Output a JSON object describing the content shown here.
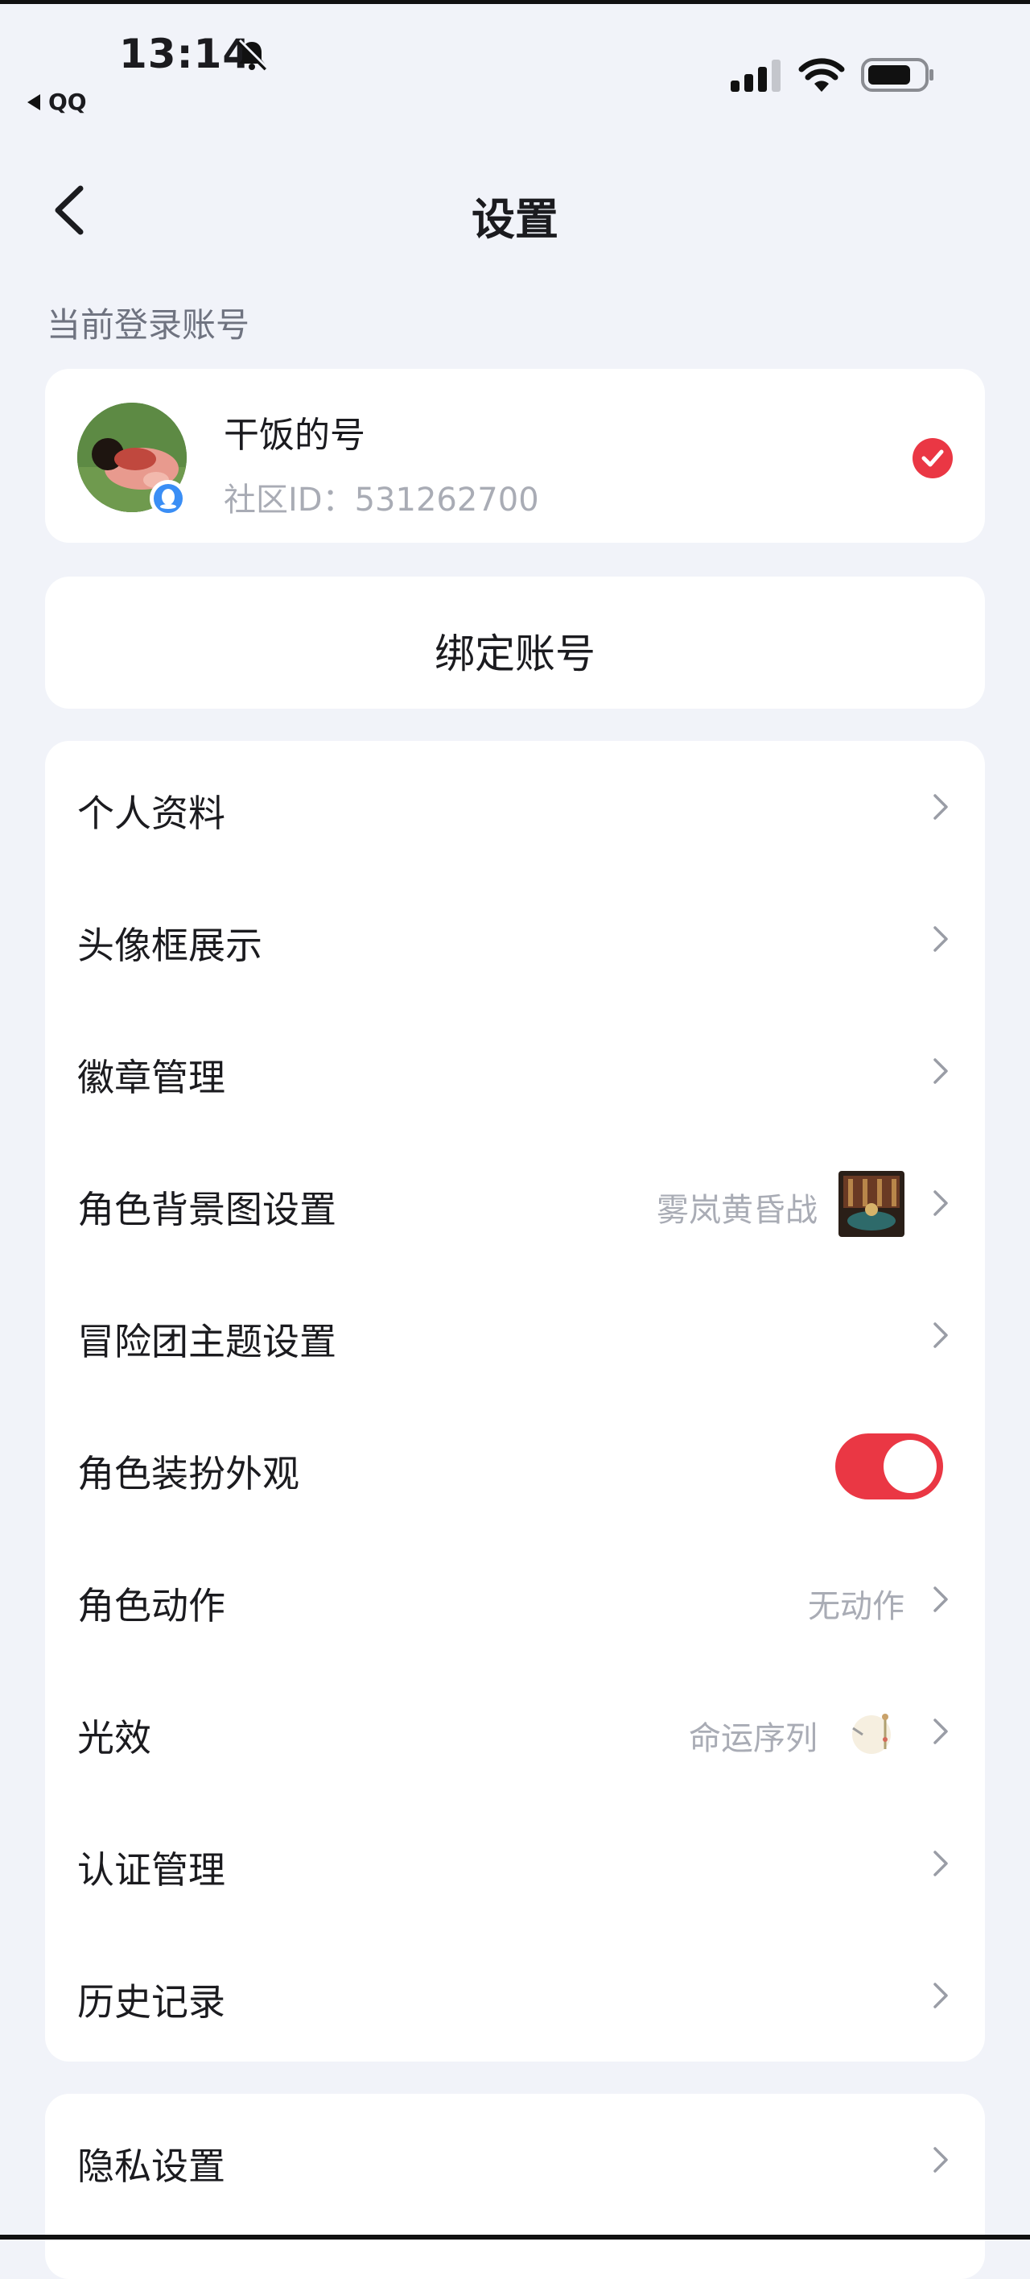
{
  "status_bar": {
    "time": "13:14",
    "back_app": "QQ",
    "icons": [
      "bell-mute-icon",
      "signal-icon",
      "wifi-icon",
      "battery-icon"
    ]
  },
  "nav": {
    "title": "设置",
    "back_icon": "chevron-left-icon"
  },
  "account": {
    "section_label": "当前登录账号",
    "name": "干饭的号",
    "community_id": "社区ID：531262700",
    "selected": true
  },
  "bind": {
    "label": "绑定账号"
  },
  "menu": {
    "items": [
      {
        "label": "个人资料"
      },
      {
        "label": "头像框展示"
      },
      {
        "label": "徽章管理"
      },
      {
        "label": "角色背景图设置",
        "value": "雾岚黄昏战"
      },
      {
        "label": "冒险团主题设置"
      },
      {
        "label": "角色装扮外观",
        "toggle": true
      },
      {
        "label": "角色动作",
        "value": "无动作"
      },
      {
        "label": "光效",
        "value": "命运序列"
      },
      {
        "label": "认证管理"
      },
      {
        "label": "历史记录"
      }
    ]
  },
  "privacy": {
    "label": "隐私设置"
  },
  "colors": {
    "accent": "#ea3744",
    "background": "#f1f3f9",
    "muted_text": "#a9acb5"
  }
}
